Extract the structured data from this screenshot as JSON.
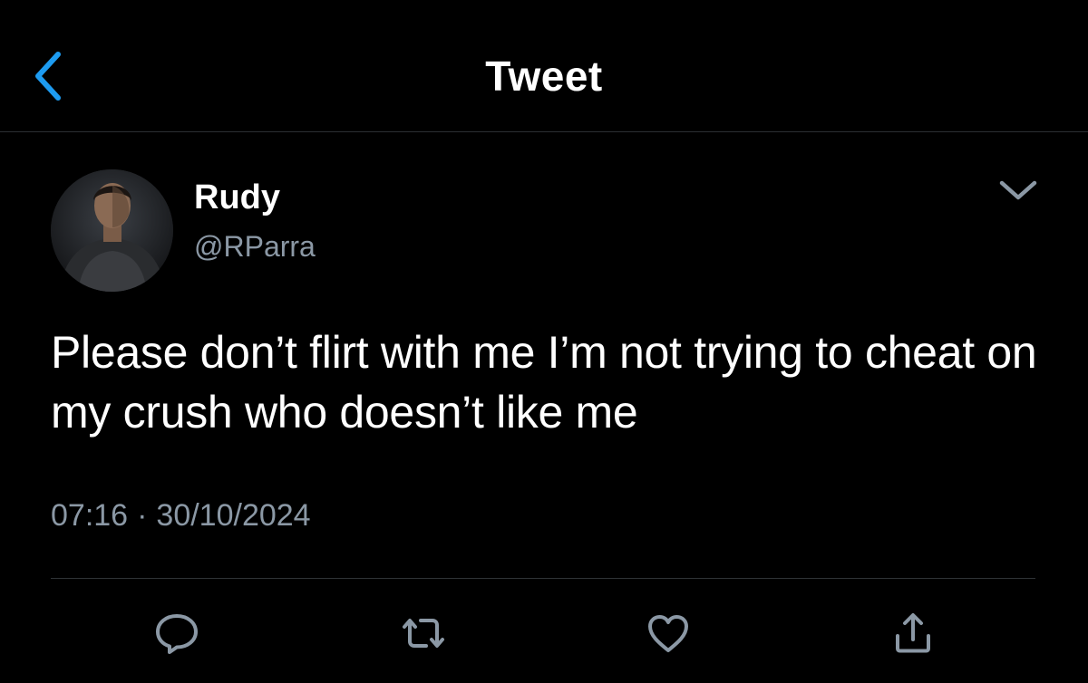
{
  "header": {
    "title": "Tweet",
    "back_icon": "chevron-left-icon",
    "accent_color": "#1d9bf0"
  },
  "tweet": {
    "author_name": "Rudy",
    "author_handle": "@RParra",
    "text": "Please don’t flirt with me I’m not trying to cheat on my crush who doesn’t like me",
    "time": "07:16",
    "separator": "·",
    "date": "30/10/2024",
    "more_icon": "chevron-down-icon"
  },
  "actions": [
    {
      "icon": "reply-icon"
    },
    {
      "icon": "retweet-icon"
    },
    {
      "icon": "like-icon"
    },
    {
      "icon": "share-icon"
    }
  ],
  "colors": {
    "background": "#000000",
    "text_primary": "#ffffff",
    "text_secondary": "#8b98a5",
    "divider": "#2f3336",
    "icon": "#8b98a5"
  }
}
